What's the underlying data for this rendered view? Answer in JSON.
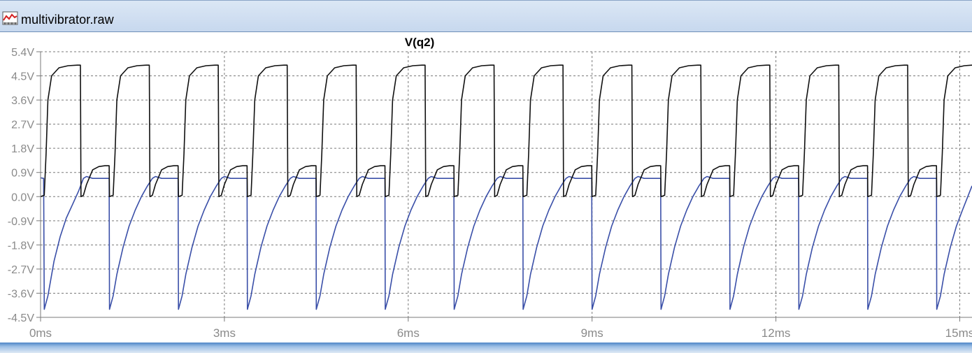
{
  "window": {
    "title": "multivibrator.raw",
    "icon": "waveform-icon"
  },
  "colors": {
    "background": "#ffffff",
    "grid": "#7a7a7a",
    "axis_text": "#8a8a8a",
    "trace_q2": "#111111",
    "trace_other": "#3a4fa8",
    "titlebar": "#cfdef0"
  },
  "chart_data": {
    "type": "line",
    "title": "V(q2)",
    "xlabel": "",
    "ylabel": "",
    "x_unit": "ms",
    "y_unit": "V",
    "xlim": [
      0,
      15.2
    ],
    "ylim": [
      -4.5,
      5.4
    ],
    "x_ticks": [
      "0ms",
      "3ms",
      "6ms",
      "9ms",
      "12ms",
      "15ms"
    ],
    "y_ticks": [
      "5.4V",
      "4.5V",
      "3.6V",
      "2.7V",
      "1.8V",
      "0.9V",
      "0.0V",
      "-0.9V",
      "-1.8V",
      "-2.7V",
      "-3.6V",
      "-4.5V"
    ],
    "grid": true,
    "period_ms": 1.125,
    "series": [
      {
        "name": "V(q2)",
        "color": "#111111",
        "description": "square wave: ~0.0V low, ~1.15V shelf, ~4.9V high",
        "x": [
          0.0,
          0.06,
          0.09,
          0.12,
          0.18,
          0.3,
          0.45,
          0.6,
          0.65,
          0.66,
          0.7,
          0.75,
          0.85,
          0.95,
          1.05,
          1.12,
          1.125,
          1.185,
          1.215,
          1.245,
          1.305,
          1.425,
          1.575,
          1.725,
          1.775,
          1.785,
          1.825,
          1.875,
          1.975,
          2.075,
          2.175,
          2.245,
          2.25,
          2.31,
          2.34,
          2.37,
          2.43,
          2.55,
          2.7,
          2.85,
          2.9,
          2.91,
          2.95,
          3.0,
          3.1,
          3.2,
          3.3,
          3.37,
          3.375,
          3.435,
          3.465,
          3.495,
          3.555,
          3.675,
          3.825,
          3.975,
          4.025,
          4.035,
          4.075,
          4.125,
          4.225,
          4.325,
          4.425,
          4.495,
          4.5,
          4.56,
          4.59,
          4.62,
          4.68,
          4.8,
          4.95,
          5.1,
          5.15,
          5.16,
          5.2,
          5.25,
          5.35,
          5.45,
          5.55,
          5.62,
          5.625,
          5.685,
          5.715,
          5.745,
          5.805,
          5.925,
          6.075,
          6.225,
          6.275,
          6.285,
          6.325,
          6.375,
          6.475,
          6.575,
          6.675,
          6.745,
          6.75,
          6.81,
          6.84,
          6.87,
          6.93,
          7.05,
          7.2,
          7.35,
          7.4,
          7.41,
          7.45,
          7.5,
          7.6,
          7.7,
          7.8,
          7.87,
          7.875,
          7.935,
          7.965,
          7.995,
          8.055,
          8.175,
          8.325,
          8.475,
          8.525,
          8.535,
          8.575,
          8.625,
          8.725,
          8.825,
          8.925,
          8.995,
          9.0,
          9.06,
          9.09,
          9.12,
          9.18,
          9.3,
          9.45,
          9.6,
          9.65,
          9.66,
          9.7,
          9.75,
          9.85,
          9.95,
          10.05,
          10.12,
          10.125,
          10.185,
          10.215,
          10.245,
          10.305,
          10.425,
          10.575,
          10.725,
          10.775,
          10.785,
          10.825,
          10.875,
          10.975,
          11.075,
          11.175,
          11.245,
          11.25,
          11.31,
          11.34,
          11.37,
          11.43,
          11.55,
          11.7,
          11.85,
          11.9,
          11.91,
          11.95,
          12.0,
          12.1,
          12.2,
          12.3,
          12.37,
          12.375,
          12.435,
          12.465,
          12.495,
          12.555,
          12.675,
          12.825,
          12.975,
          13.025,
          13.035,
          13.075,
          13.125,
          13.225,
          13.325,
          13.425,
          13.495,
          13.5,
          13.56,
          13.59,
          13.62,
          13.68,
          13.8,
          13.95,
          14.1,
          14.15,
          14.16,
          14.2,
          14.25,
          14.35,
          14.45,
          14.55,
          14.62,
          14.625,
          14.685,
          14.715,
          14.745,
          14.805,
          14.925,
          15.075,
          15.2
        ],
        "y": [
          0.0,
          0.05,
          1.6,
          3.6,
          4.5,
          4.8,
          4.88,
          4.9,
          4.9,
          0.0,
          0.05,
          0.45,
          1.0,
          1.12,
          1.15,
          1.15,
          0.0,
          0.05,
          1.6,
          3.6,
          4.5,
          4.8,
          4.88,
          4.9,
          4.9,
          0.0,
          0.05,
          0.45,
          1.0,
          1.12,
          1.15,
          1.15,
          0.0,
          0.05,
          1.6,
          3.6,
          4.5,
          4.8,
          4.88,
          4.9,
          4.9,
          0.0,
          0.05,
          0.45,
          1.0,
          1.12,
          1.15,
          1.15,
          0.0,
          0.05,
          1.6,
          3.6,
          4.5,
          4.8,
          4.88,
          4.9,
          4.9,
          0.0,
          0.05,
          0.45,
          1.0,
          1.12,
          1.15,
          1.15,
          0.0,
          0.05,
          1.6,
          3.6,
          4.5,
          4.8,
          4.88,
          4.9,
          4.9,
          0.0,
          0.05,
          0.45,
          1.0,
          1.12,
          1.15,
          1.15,
          0.0,
          0.05,
          1.6,
          3.6,
          4.5,
          4.8,
          4.88,
          4.9,
          4.9,
          0.0,
          0.05,
          0.45,
          1.0,
          1.12,
          1.15,
          1.15,
          0.0,
          0.05,
          1.6,
          3.6,
          4.5,
          4.8,
          4.88,
          4.9,
          4.9,
          0.0,
          0.05,
          0.45,
          1.0,
          1.12,
          1.15,
          1.15,
          0.0,
          0.05,
          1.6,
          3.6,
          4.5,
          4.8,
          4.88,
          4.9,
          4.9,
          0.0,
          0.05,
          0.45,
          1.0,
          1.12,
          1.15,
          1.15,
          0.0,
          0.05,
          1.6,
          3.6,
          4.5,
          4.8,
          4.88,
          4.9,
          4.9,
          0.0,
          0.05,
          0.45,
          1.0,
          1.12,
          1.15,
          1.15,
          0.0,
          0.05,
          1.6,
          3.6,
          4.5,
          4.8,
          4.88,
          4.9,
          4.9,
          0.0,
          0.05,
          0.45,
          1.0,
          1.12,
          1.15,
          1.15,
          0.0,
          0.05,
          1.6,
          3.6,
          4.5,
          4.8,
          4.88,
          4.9,
          4.9,
          0.0,
          0.05,
          0.45,
          1.0,
          1.12,
          1.15,
          1.15,
          0.0,
          0.05,
          1.6,
          3.6,
          4.5,
          4.8,
          4.88,
          4.9,
          4.9,
          0.0,
          0.05,
          0.45,
          1.0,
          1.12,
          1.15,
          1.15,
          0.0,
          0.05,
          1.6,
          3.6,
          4.5,
          4.8,
          4.88,
          4.9,
          4.9,
          0.0,
          0.05,
          0.45,
          1.0,
          1.12,
          1.15,
          1.15,
          0.0,
          0.05,
          1.6,
          3.6,
          4.5,
          4.8,
          4.88,
          4.9
        ]
      },
      {
        "name": "",
        "color": "#3a4fa8",
        "description": "base drive: ~0.68V high plateau, sharp drop to ~-4.2V, exponential recovery",
        "x": [
          0.0,
          0.05,
          0.06,
          0.12,
          0.22,
          0.32,
          0.42,
          0.52,
          0.62,
          0.7,
          0.75,
          0.85,
          1.12,
          1.125,
          1.185,
          1.245,
          1.345,
          1.445,
          1.545,
          1.645,
          1.745,
          1.825,
          1.875,
          1.975,
          2.245,
          2.25,
          2.31,
          2.37,
          2.47,
          2.57,
          2.67,
          2.77,
          2.87,
          2.95,
          3.0,
          3.1,
          3.37,
          3.375,
          3.435,
          3.495,
          3.595,
          3.695,
          3.795,
          3.895,
          3.995,
          4.075,
          4.125,
          4.225,
          4.495,
          4.5,
          4.56,
          4.62,
          4.72,
          4.82,
          4.92,
          5.02,
          5.12,
          5.2,
          5.25,
          5.35,
          5.62,
          5.625,
          5.685,
          5.745,
          5.845,
          5.945,
          6.045,
          6.145,
          6.245,
          6.325,
          6.375,
          6.475,
          6.745,
          6.75,
          6.81,
          6.87,
          6.97,
          7.07,
          7.17,
          7.27,
          7.37,
          7.45,
          7.5,
          7.6,
          7.87,
          7.875,
          7.935,
          7.995,
          8.095,
          8.195,
          8.295,
          8.395,
          8.495,
          8.575,
          8.625,
          8.725,
          8.995,
          9.0,
          9.06,
          9.12,
          9.22,
          9.32,
          9.42,
          9.52,
          9.62,
          9.7,
          9.75,
          9.85,
          10.12,
          10.125,
          10.185,
          10.245,
          10.345,
          10.445,
          10.545,
          10.645,
          10.745,
          10.825,
          10.875,
          10.975,
          11.245,
          11.25,
          11.31,
          11.37,
          11.47,
          11.57,
          11.67,
          11.77,
          11.87,
          11.95,
          12.0,
          12.1,
          12.37,
          12.375,
          12.435,
          12.495,
          12.595,
          12.695,
          12.795,
          12.895,
          12.995,
          13.075,
          13.125,
          13.225,
          13.495,
          13.5,
          13.56,
          13.62,
          13.72,
          13.82,
          13.92,
          14.02,
          14.12,
          14.2,
          14.25,
          14.35,
          14.62,
          14.625,
          14.685,
          14.745,
          14.845,
          14.945,
          15.045,
          15.2
        ],
        "y": [
          0.7,
          0.68,
          -4.2,
          -3.7,
          -2.4,
          -1.5,
          -0.8,
          -0.3,
          0.2,
          0.68,
          0.75,
          0.68,
          0.68,
          -4.2,
          -3.7,
          -2.9,
          -1.9,
          -1.1,
          -0.5,
          0.0,
          0.4,
          0.68,
          0.75,
          0.68,
          0.68,
          -4.2,
          -3.7,
          -2.9,
          -1.9,
          -1.1,
          -0.5,
          0.0,
          0.4,
          0.68,
          0.75,
          0.68,
          0.68,
          -4.2,
          -3.7,
          -2.9,
          -1.9,
          -1.1,
          -0.5,
          0.0,
          0.4,
          0.68,
          0.75,
          0.68,
          0.68,
          -4.2,
          -3.7,
          -2.9,
          -1.9,
          -1.1,
          -0.5,
          0.0,
          0.4,
          0.68,
          0.75,
          0.68,
          0.68,
          -4.2,
          -3.7,
          -2.9,
          -1.9,
          -1.1,
          -0.5,
          0.0,
          0.4,
          0.68,
          0.75,
          0.68,
          0.68,
          -4.2,
          -3.7,
          -2.9,
          -1.9,
          -1.1,
          -0.5,
          0.0,
          0.4,
          0.68,
          0.75,
          0.68,
          0.68,
          -4.2,
          -3.7,
          -2.9,
          -1.9,
          -1.1,
          -0.5,
          0.0,
          0.4,
          0.68,
          0.75,
          0.68,
          0.68,
          -4.2,
          -3.7,
          -2.9,
          -1.9,
          -1.1,
          -0.5,
          0.0,
          0.4,
          0.68,
          0.75,
          0.68,
          0.68,
          -4.2,
          -3.7,
          -2.9,
          -1.9,
          -1.1,
          -0.5,
          0.0,
          0.4,
          0.68,
          0.75,
          0.68,
          0.68,
          -4.2,
          -3.7,
          -2.9,
          -1.9,
          -1.1,
          -0.5,
          0.0,
          0.4,
          0.68,
          0.75,
          0.68,
          0.68,
          -4.2,
          -3.7,
          -2.9,
          -1.9,
          -1.1,
          -0.5,
          0.0,
          0.4,
          0.68,
          0.75,
          0.68,
          0.68,
          -4.2,
          -3.7,
          -2.9,
          -1.9,
          -1.1,
          -0.5,
          0.0,
          0.4,
          0.68,
          0.75,
          0.68,
          0.68,
          -4.2,
          -3.7,
          -2.9,
          -1.9,
          -1.1,
          -0.5,
          0.4
        ]
      }
    ]
  }
}
